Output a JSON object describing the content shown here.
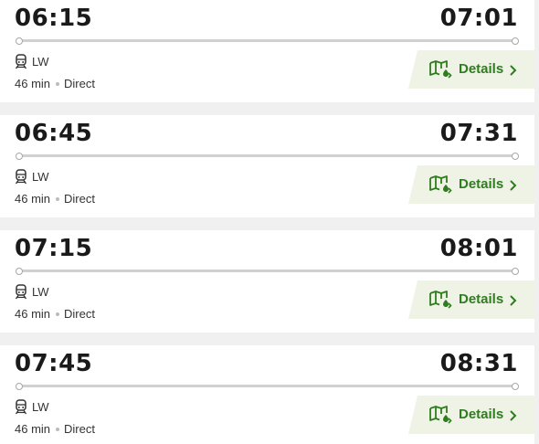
{
  "colors": {
    "accent": "#2f7d1f",
    "details_bg": "#eef3e6",
    "page_bg": "#f0f0f0",
    "card_bg": "#ffffff"
  },
  "journeys": [
    {
      "departure": "06:15",
      "arrival": "07:01",
      "operator_icon": "train-icon",
      "operator_code": "LW",
      "duration": "46 min",
      "changes": "Direct",
      "details_label": "Details"
    },
    {
      "departure": "06:45",
      "arrival": "07:31",
      "operator_icon": "train-icon",
      "operator_code": "LW",
      "duration": "46 min",
      "changes": "Direct",
      "details_label": "Details"
    },
    {
      "departure": "07:15",
      "arrival": "08:01",
      "operator_icon": "train-icon",
      "operator_code": "LW",
      "duration": "46 min",
      "changes": "Direct",
      "details_label": "Details"
    },
    {
      "departure": "07:45",
      "arrival": "08:31",
      "operator_icon": "train-icon",
      "operator_code": "LW",
      "duration": "46 min",
      "changes": "Direct",
      "details_label": "Details"
    }
  ]
}
